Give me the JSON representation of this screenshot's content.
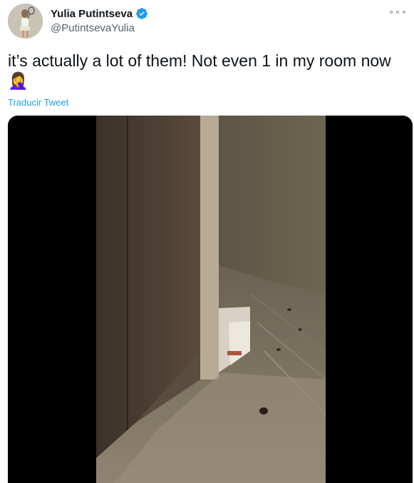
{
  "author": {
    "display_name": "Yulia Putintseva",
    "handle": "@PutintsevaYulia",
    "verified_icon": "verified-badge-icon",
    "avatar": "tennis-player-avatar"
  },
  "tweet": {
    "text": "it’s actually a lot of them! Not even 1 in my room now",
    "emoji": "🤦‍♀️",
    "translate_label": "Traducir Tweet"
  },
  "media": {
    "type": "video",
    "description_icon": "video-frame-room-floor"
  },
  "colors": {
    "accent": "#1d9bf0",
    "text": "#0f1419",
    "secondary": "#536471"
  }
}
